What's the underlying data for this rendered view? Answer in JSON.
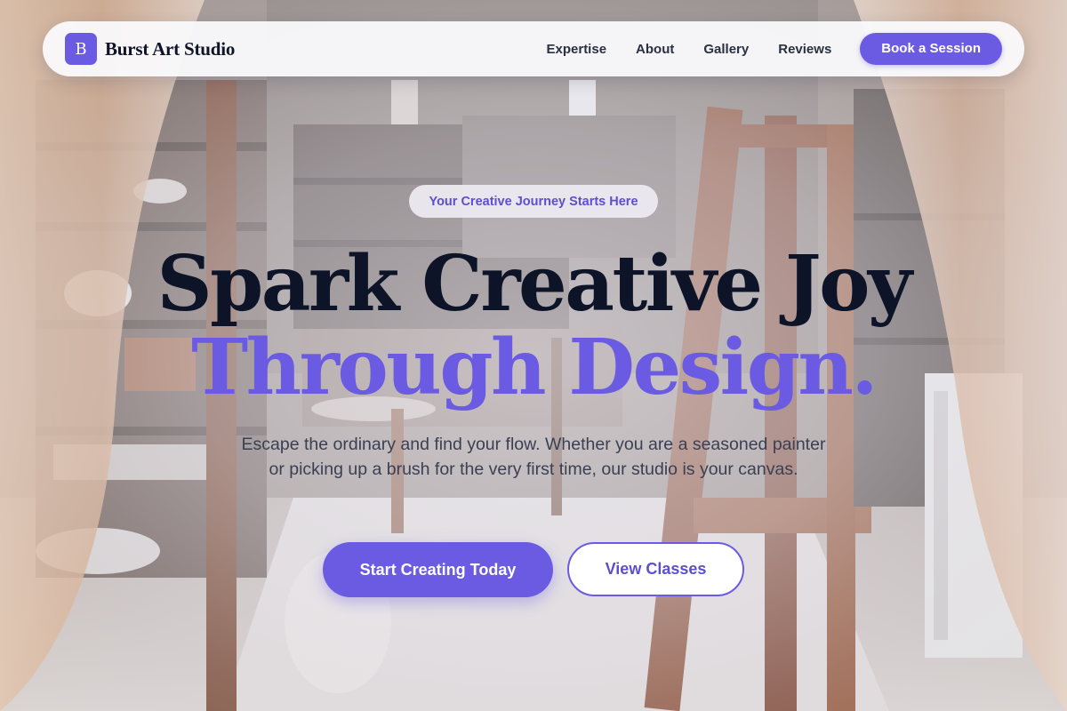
{
  "navbar": {
    "logo_letter": "B",
    "brand_name": "Burst Art Studio",
    "links": [
      "Expertise",
      "About",
      "Gallery",
      "Reviews"
    ],
    "cta_label": "Book a Session"
  },
  "hero": {
    "tagline": "Your Creative Journey Starts Here",
    "headline_line1": "Spark Creative Joy",
    "headline_line2": "Through Design.",
    "description": "Escape the ordinary and find your flow. Whether you are a seasoned painter or picking up a brush for the very first time, our studio is your canvas.",
    "primary_button": "Start Creating Today",
    "secondary_button": "View Classes"
  },
  "colors": {
    "accent": "#6a5be2",
    "heading": "#0e1428",
    "body_text": "#3a3f52"
  }
}
